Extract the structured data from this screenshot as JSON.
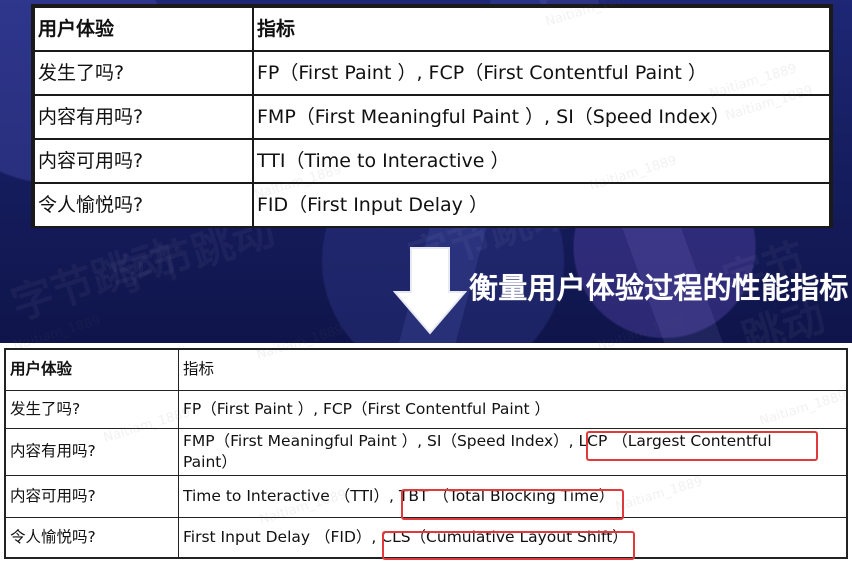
{
  "top_table": {
    "header": {
      "experience": "用户体验",
      "metrics": "指标"
    },
    "rows": [
      {
        "question": "发生了吗?",
        "metrics": "FP（First Paint ）, FCP（First Contentful Paint ）"
      },
      {
        "question": "内容有用吗?",
        "metrics": "FMP（First Meaningful Paint ）, SI（Speed Index）"
      },
      {
        "question": "内容可用吗?",
        "metrics": "TTI（Time to Interactive ）"
      },
      {
        "question": "令人愉悦吗?",
        "metrics": "FID（First Input Delay ）"
      }
    ]
  },
  "banner": {
    "title": "衡量用户体验过程的性能指标"
  },
  "bottom_table": {
    "header": {
      "experience": "用户体验",
      "metrics": "指标"
    },
    "rows": [
      {
        "question": "发生了吗?",
        "metrics_line_1": "FP（First Paint ）, FCP（First Contentful Paint ）",
        "metrics_line_2": ""
      },
      {
        "question": "内容有用吗?",
        "metrics_line_1": "FMP（First Meaningful Paint ）, SI（Speed Index）, LCP （Largest Contentful",
        "metrics_line_2": "Paint）"
      },
      {
        "question": "内容可用吗?",
        "metrics_line_1": "Time to Interactive （TTI）, TBT （Total Blocking Time）",
        "metrics_line_2": ""
      },
      {
        "question": "令人愉悦吗?",
        "metrics_line_1": "First Input Delay （FID）, CLS（Cumulative Layout Shift）",
        "metrics_line_2": ""
      }
    ]
  },
  "highlight_color": "#e23a3a",
  "slide_background": "#151c5c",
  "arrow_icon": "down-arrow-icon",
  "watermarks": {
    "large": "字节跳动",
    "small": "Naitiam_1889"
  }
}
